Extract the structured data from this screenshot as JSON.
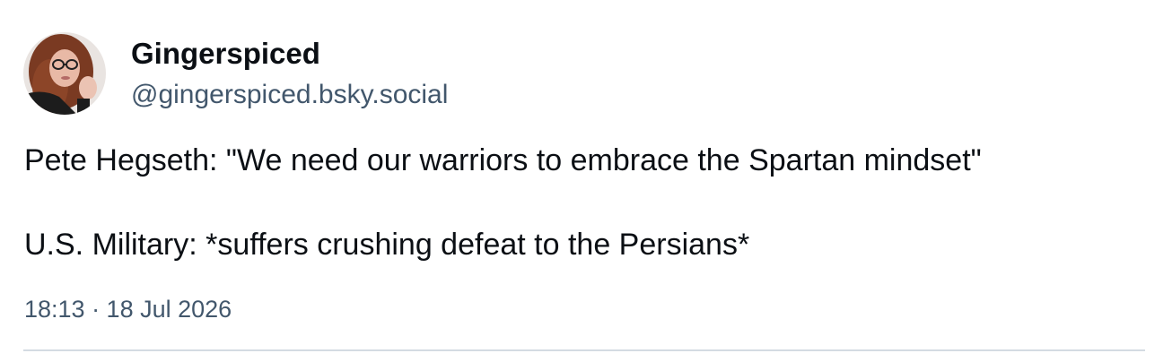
{
  "post": {
    "author": {
      "display_name": "Gingerspiced",
      "handle": "@gingerspiced.bsky.social",
      "avatar_icon": "profile-photo-avatar"
    },
    "text": {
      "line1": "Pete Hegseth: \"We need our warriors to embrace the Spartan mindset\"",
      "line2": "U.S. Military: *suffers crushing defeat to the Persians*"
    },
    "timestamp": "18:13 · 18 Jul 2026"
  },
  "colors": {
    "text_primary": "#0b0f14",
    "text_secondary": "#42576c",
    "divider": "#d4dbe2",
    "background": "#ffffff"
  }
}
